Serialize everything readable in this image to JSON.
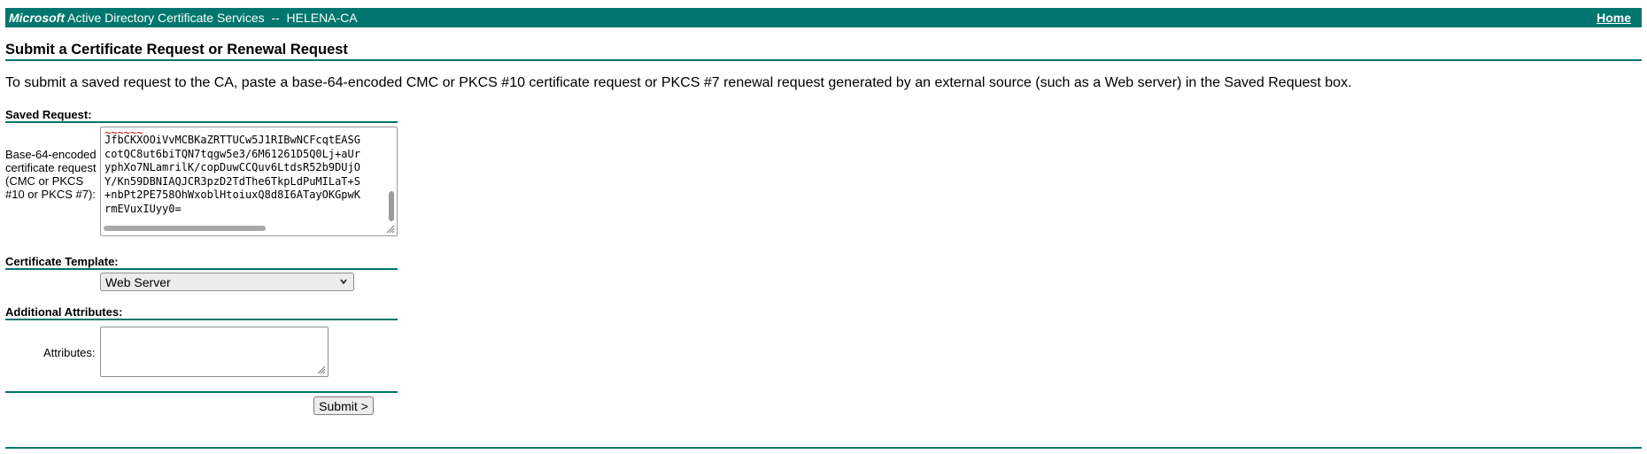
{
  "header": {
    "brand_italic": "Microsoft",
    "brand_rest": " Active Directory Certificate Services  --  HELENA-CA",
    "home_link": "Home"
  },
  "page_title": "Submit a Certificate Request or Renewal Request",
  "intro": "To submit a saved request to the CA, paste a base-64-encoded CMC or PKCS #10 certificate request or PKCS #7 renewal request generated by an external source (such as a Web server) in the Saved Request box.",
  "saved_request": {
    "section_label": "Saved Request:",
    "field_label": "Base-64-encoded certificate request (CMC or PKCS #10 or PKCS #7):",
    "lines": [
      "JfbCKXOOiVvMCBKaZRTTUCw5J1RIBwNCFcqtEASG",
      "cotQC8ut6biTQN7tqgw5e3/6M61261D5Q0Lj+aUr",
      "yphXo7NLamrilK/copDuwCCQuv6LtdsR52b9DUjO",
      "Y/Kn59DBNIAQJCR3pzD2TdThe6TkpLdPuMILaT+S",
      "+nbPt2PE758OhWxoblHtoiuxQ8d8I6ATayOKGpwK",
      "rmEVuxIUyy0="
    ]
  },
  "template": {
    "section_label": "Certificate Template:",
    "selected": "Web Server"
  },
  "attributes": {
    "section_label": "Additional Attributes:",
    "field_label": "Attributes:",
    "value": ""
  },
  "submit_label": "Submit >",
  "colors": {
    "accent": "#00766e"
  }
}
